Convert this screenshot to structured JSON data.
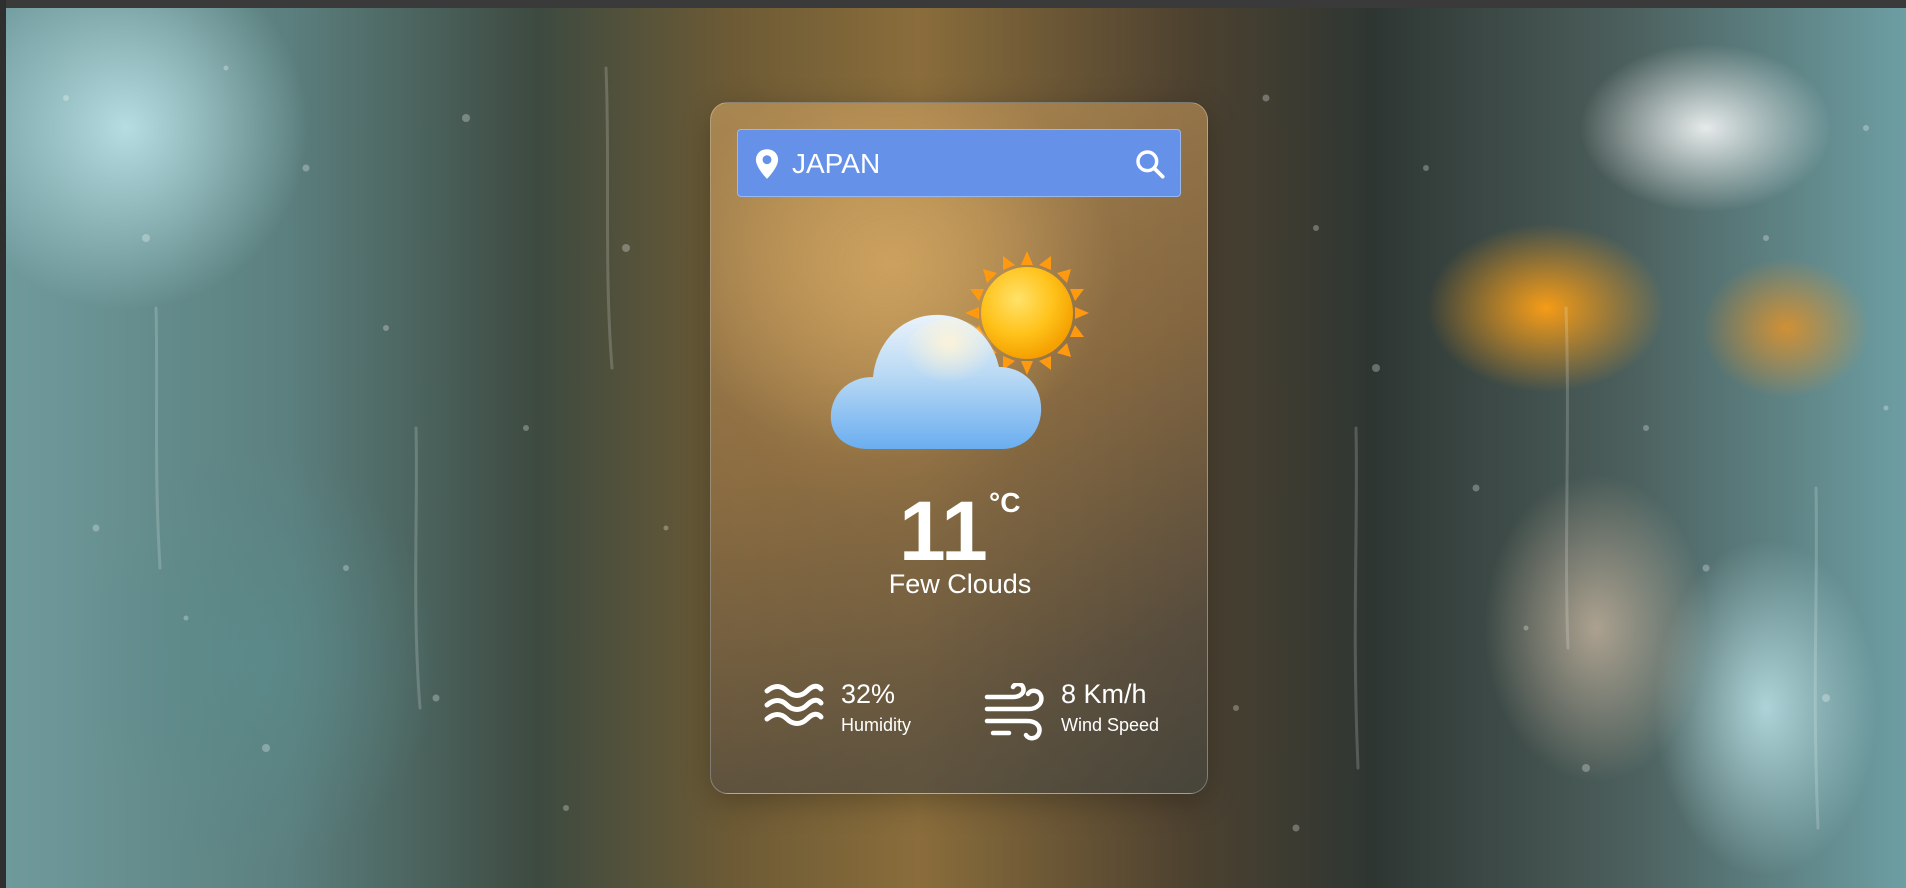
{
  "search": {
    "value": "JAPAN",
    "location_icon": "location-pin-icon",
    "search_icon": "magnifier-icon"
  },
  "weather": {
    "icon": "partly-cloudy-icon",
    "temperature": "11",
    "unit": "°C",
    "description": "Few Clouds"
  },
  "details": {
    "humidity": {
      "icon": "waves-icon",
      "value": "32%",
      "label": "Humidity"
    },
    "wind": {
      "icon": "wind-icon",
      "value": "8 Km/h",
      "label": "Wind Speed"
    }
  },
  "colors": {
    "search_bar": "#6592e8",
    "text": "#ffffff"
  }
}
